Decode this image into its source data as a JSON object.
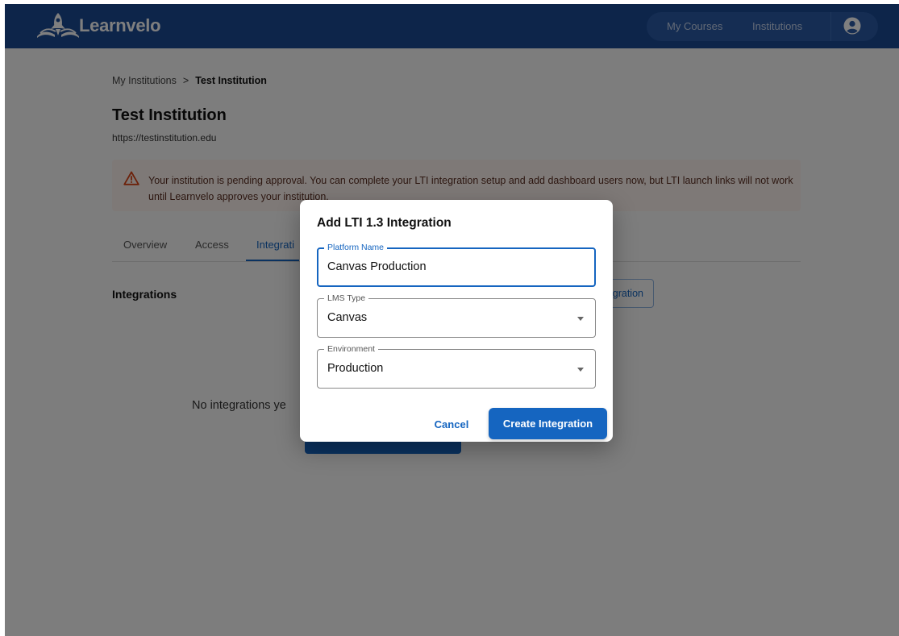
{
  "app": {
    "brand": "Learnvelo",
    "nav": {
      "my_courses": "My Courses",
      "institutions": "Institutions"
    }
  },
  "page": {
    "breadcrumb": {
      "parent": "My Institutions",
      "separator": ">",
      "current": "Test Institution"
    },
    "title": "Test Institution",
    "url": "https://testinstitution.edu",
    "alert": "Your institution is pending approval. You can complete your LTI integration setup and add dashboard users now, but LTI launch links will not work until Learnvelo approves your institution.",
    "tabs": [
      {
        "label": "Overview",
        "active": false
      },
      {
        "label": "Access",
        "active": false
      },
      {
        "label": "Integrati",
        "active": true
      }
    ],
    "section_title": "Integrations",
    "add_button_partial": "gration",
    "empty_text_partial": "No integrations ye"
  },
  "dialog": {
    "title": "Add LTI 1.3 Integration",
    "platform_name": {
      "label": "Platform Name",
      "value": "Canvas Production"
    },
    "lms_type": {
      "label": "LMS Type",
      "value": "Canvas"
    },
    "environment": {
      "label": "Environment",
      "value": "Production"
    },
    "cancel_label": "Cancel",
    "create_label": "Create Integration"
  },
  "colors": {
    "appbar": "#1a4a95",
    "primary": "#1565c0",
    "alert_bg": "#fdf3ef",
    "warning": "#d84315"
  },
  "icons": {
    "logo": "rocket-book-logo-icon",
    "account": "account-circle-icon",
    "warning": "warning-triangle-icon",
    "dropdown": "chevron-down-icon"
  }
}
